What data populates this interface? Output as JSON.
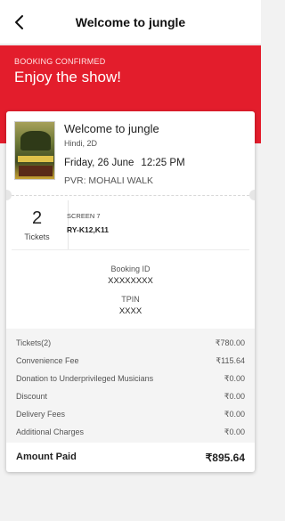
{
  "header": {
    "title": "Welcome to jungle",
    "back_icon": "back-arrow-icon"
  },
  "banner": {
    "status": "BOOKING CONFIRMED",
    "title": "Enjoy the show!",
    "color": "#e31d2c"
  },
  "movie": {
    "title": "Welcome to jungle",
    "meta": "Hindi, 2D",
    "date": "Friday, 26 June",
    "time": "12:25 PM",
    "venue": "PVR: MOHALI WALK"
  },
  "tickets": {
    "count": "2",
    "label": "Tickets",
    "screen": "SCREEN 7",
    "seats": "RY-K12,K11"
  },
  "booking": {
    "id_label": "Booking ID",
    "id_value": "XXXXXXXX",
    "tpin_label": "TPIN",
    "tpin_value": "XXXX"
  },
  "charges": [
    {
      "label": "Tickets(2)",
      "value": "₹780.00"
    },
    {
      "label": "Convenience Fee",
      "value": "₹115.64"
    },
    {
      "label": "Donation to Underprivileged Musicians",
      "value": "₹0.00"
    },
    {
      "label": "Discount",
      "value": "₹0.00"
    },
    {
      "label": "Delivery Fees",
      "value": "₹0.00"
    },
    {
      "label": "Additional Charges",
      "value": "₹0.00"
    }
  ],
  "total": {
    "label": "Amount Paid",
    "value": "₹895.64"
  }
}
